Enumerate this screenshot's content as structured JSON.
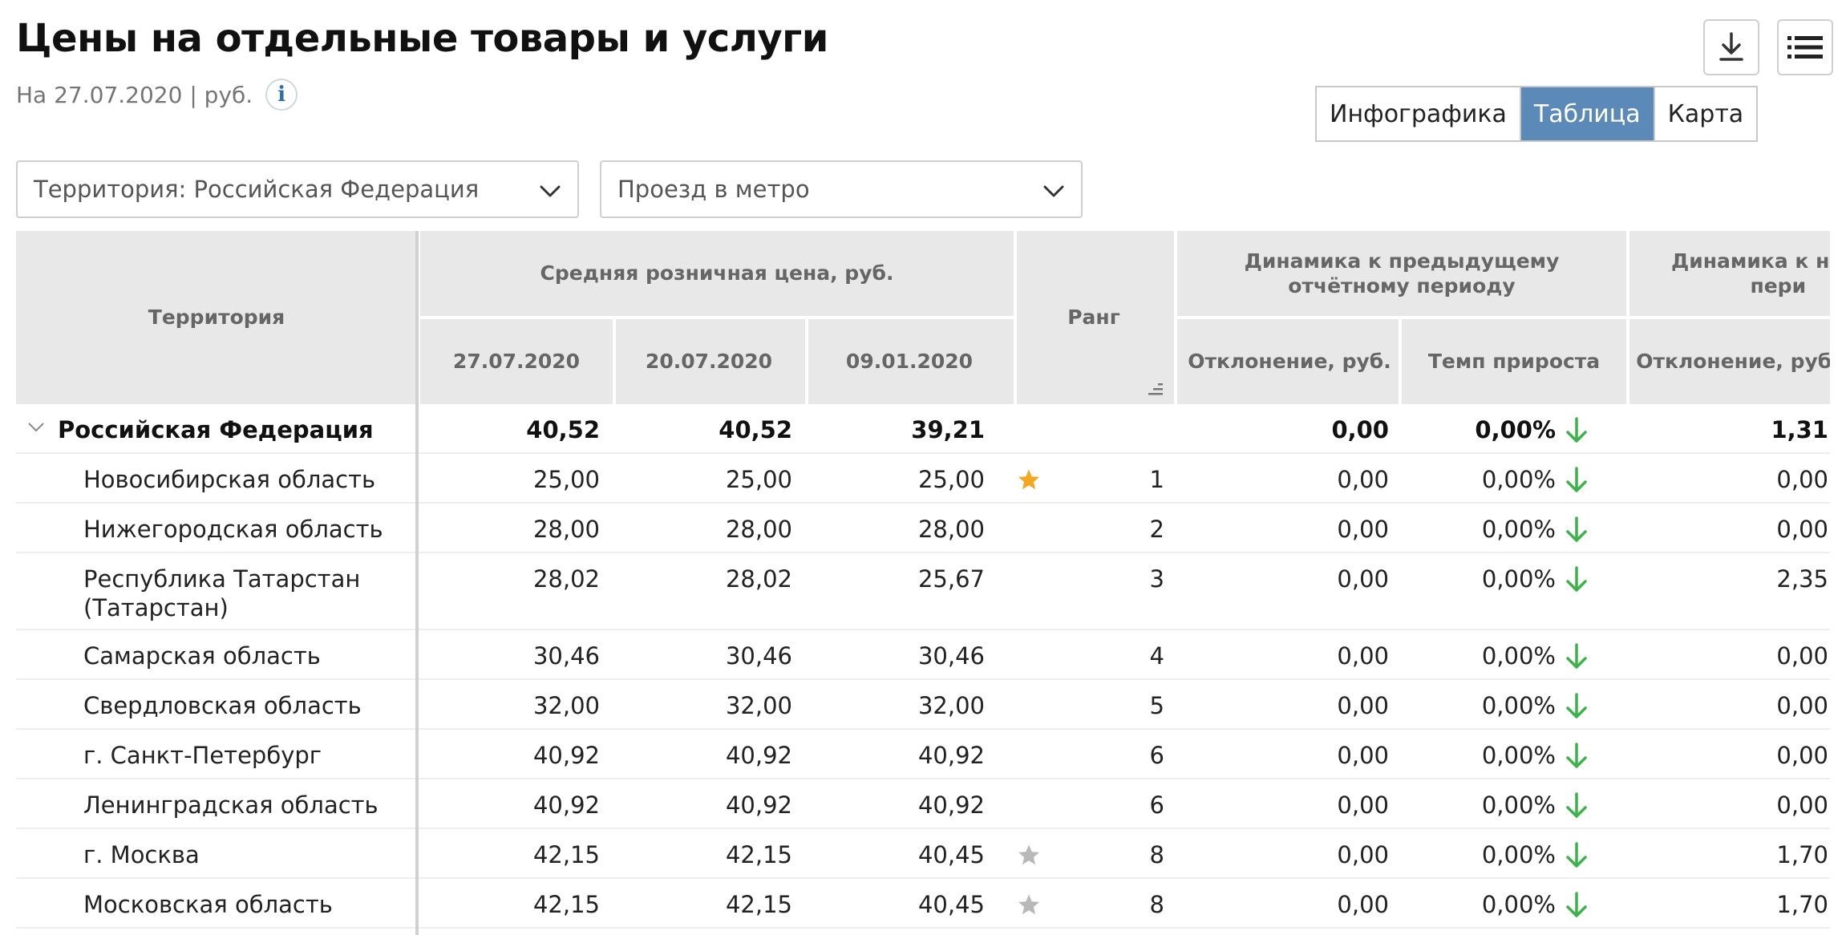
{
  "page": {
    "title": "Цены на отдельные товары и услуги",
    "subtitle": "На 27.07.2020 | руб.",
    "info_icon": "i"
  },
  "toolbar": {
    "download_icon": "download-icon",
    "list_icon": "list-icon"
  },
  "view_tabs": [
    {
      "label": "Инфографика",
      "active": false
    },
    {
      "label": "Таблица",
      "active": true
    },
    {
      "label": "Карта",
      "active": false
    }
  ],
  "filters": {
    "territory": "Территория: Российская  Федерация",
    "product": "Проезд в метро"
  },
  "table": {
    "headers": {
      "territory": "Территория",
      "avg_price": "Средняя розничная цена, руб.",
      "date1": "27.07.2020",
      "date2": "20.07.2020",
      "date3": "09.01.2020",
      "rank": "Ранг",
      "dyn_prev": "Динамика к предыдущему отчётному периоду",
      "dyn_prev_dev": "Отклонение, руб.",
      "dyn_prev_rate": "Темп прироста",
      "dyn_start": "Динамика к начал\nпери",
      "dyn_start_dev": "Отклонение, руб."
    },
    "colors": {
      "star_gold": "#f5a623",
      "star_gray": "#b8b8b8",
      "arrow_green": "#3cb34a",
      "header_bg": "#e8e8e8"
    },
    "rows": [
      {
        "name": "Российская Федерация",
        "total": true,
        "p1": "40,52",
        "p2": "40,52",
        "p3": "39,21",
        "rank": "",
        "star": "",
        "dev": "0,00",
        "rate": "0,00%",
        "dev2": "1,31"
      },
      {
        "name": "Новосибирская область",
        "p1": "25,00",
        "p2": "25,00",
        "p3": "25,00",
        "rank": "1",
        "star": "gold",
        "dev": "0,00",
        "rate": "0,00%",
        "dev2": "0,00"
      },
      {
        "name": "Нижегородская область",
        "p1": "28,00",
        "p2": "28,00",
        "p3": "28,00",
        "rank": "2",
        "star": "",
        "dev": "0,00",
        "rate": "0,00%",
        "dev2": "0,00"
      },
      {
        "name": "Республика Татарстан\n(Татарстан)",
        "p1": "28,02",
        "p2": "28,02",
        "p3": "25,67",
        "rank": "3",
        "star": "",
        "dev": "0,00",
        "rate": "0,00%",
        "dev2": "2,35"
      },
      {
        "name": "Самарская область",
        "p1": "30,46",
        "p2": "30,46",
        "p3": "30,46",
        "rank": "4",
        "star": "",
        "dev": "0,00",
        "rate": "0,00%",
        "dev2": "0,00"
      },
      {
        "name": "Свердловская область",
        "p1": "32,00",
        "p2": "32,00",
        "p3": "32,00",
        "rank": "5",
        "star": "",
        "dev": "0,00",
        "rate": "0,00%",
        "dev2": "0,00"
      },
      {
        "name": "г. Санкт-Петербург",
        "p1": "40,92",
        "p2": "40,92",
        "p3": "40,92",
        "rank": "6",
        "star": "",
        "dev": "0,00",
        "rate": "0,00%",
        "dev2": "0,00"
      },
      {
        "name": "Ленинградская область",
        "p1": "40,92",
        "p2": "40,92",
        "p3": "40,92",
        "rank": "6",
        "star": "",
        "dev": "0,00",
        "rate": "0,00%",
        "dev2": "0,00"
      },
      {
        "name": "г. Москва",
        "p1": "42,15",
        "p2": "42,15",
        "p3": "40,45",
        "rank": "8",
        "star": "gray",
        "dev": "0,00",
        "rate": "0,00%",
        "dev2": "1,70"
      },
      {
        "name": "Московская область",
        "p1": "42,15",
        "p2": "42,15",
        "p3": "40,45",
        "rank": "8",
        "star": "gray",
        "dev": "0,00",
        "rate": "0,00%",
        "dev2": "1,70"
      }
    ]
  }
}
